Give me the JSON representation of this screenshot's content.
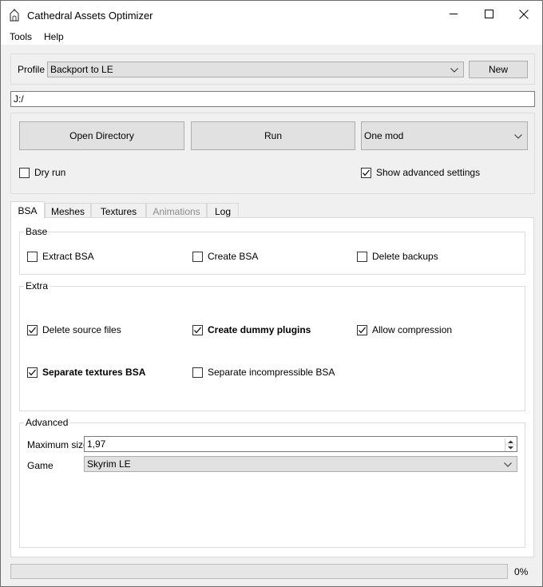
{
  "window": {
    "title": "Cathedral Assets Optimizer",
    "controls": [
      "minimize",
      "maximize",
      "close"
    ]
  },
  "menu": {
    "items": [
      "Tools",
      "Help"
    ]
  },
  "profile": {
    "label": "Profile",
    "selected": "Backport to LE",
    "new_button": "New"
  },
  "path": {
    "value": "J:/"
  },
  "actions": {
    "open_directory": "Open Directory",
    "run": "Run",
    "mode_selected": "One mod",
    "dry_run": {
      "label": "Dry run",
      "checked": false
    },
    "show_advanced": {
      "label": "Show advanced settings",
      "checked": true
    }
  },
  "tabs": [
    {
      "label": "BSA",
      "active": true,
      "enabled": true
    },
    {
      "label": "Meshes",
      "active": false,
      "enabled": true
    },
    {
      "label": "Textures",
      "active": false,
      "enabled": true
    },
    {
      "label": "Animations",
      "active": false,
      "enabled": false
    },
    {
      "label": "Log",
      "active": false,
      "enabled": true
    }
  ],
  "bsa": {
    "base": {
      "title": "Base",
      "extract_bsa": {
        "label": "Extract BSA",
        "checked": false
      },
      "create_bsa": {
        "label": "Create BSA",
        "checked": false
      },
      "delete_backups": {
        "label": "Delete backups",
        "checked": false
      }
    },
    "extra": {
      "title": "Extra",
      "delete_source_files": {
        "label": "Delete source files",
        "checked": true
      },
      "create_dummy_plugins": {
        "label": "Create dummy plugins",
        "checked": true
      },
      "allow_compression": {
        "label": "Allow compression",
        "checked": true
      },
      "separate_textures_bsa": {
        "label": "Separate textures BSA",
        "checked": true
      },
      "separate_incompressible_bsa": {
        "label": "Separate incompressible BSA",
        "checked": false
      }
    },
    "advanced": {
      "title": "Advanced",
      "max_size_label": "Maximum size",
      "max_size_value": "1,97",
      "game_label": "Game",
      "game_selected": "Skyrim LE"
    }
  },
  "progress": {
    "value": 0,
    "text": "0%"
  },
  "colors": {
    "window_bg": "#f0f0f0",
    "panel_bg": "#ffffff",
    "button_bg": "#e1e1e1",
    "border": "#adadad"
  }
}
